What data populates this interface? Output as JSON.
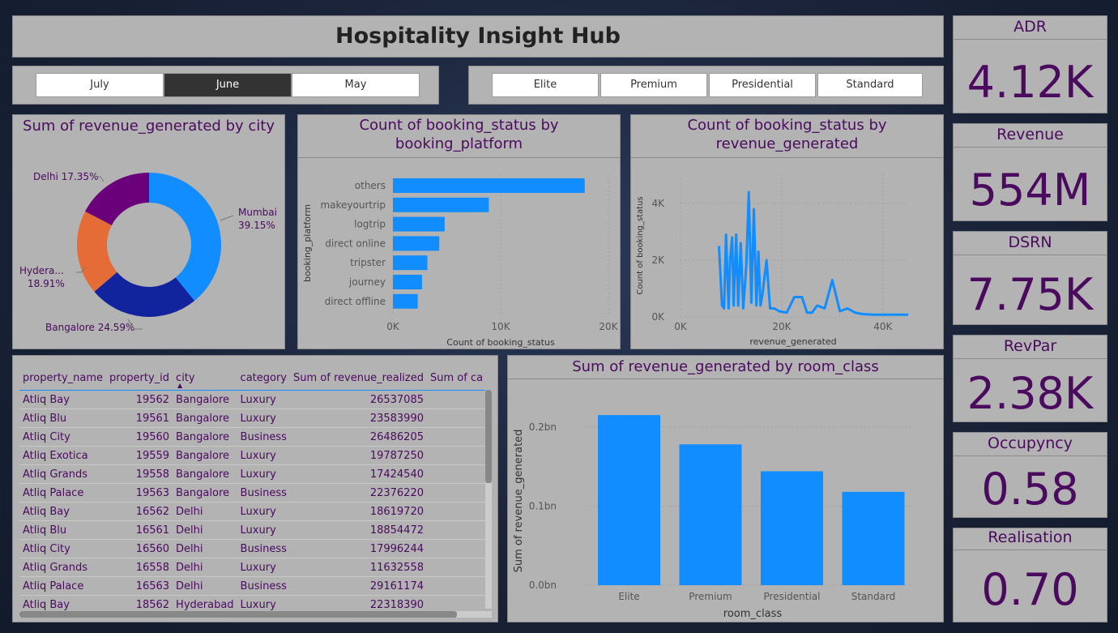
{
  "header": {
    "title": "Hospitality Insight Hub"
  },
  "month_slicer": {
    "options": [
      "July",
      "June",
      "May"
    ],
    "selected": "June"
  },
  "class_slicer": {
    "options": [
      "Elite",
      "Premium",
      "Presidential",
      "Standard"
    ]
  },
  "kpis": [
    {
      "label": "ADR",
      "value": "4.12K"
    },
    {
      "label": "Revenue",
      "value": "554M"
    },
    {
      "label": "DSRN",
      "value": "7.75K"
    },
    {
      "label": "RevPar",
      "value": "2.38K"
    },
    {
      "label": "Occupyncy",
      "value": "0.58"
    },
    {
      "label": "Realisation",
      "value": "0.70"
    }
  ],
  "colors": {
    "accent": "#118dff",
    "title_text": "#4a0a5e",
    "panel": "#b3b3b3"
  },
  "chart_data": [
    {
      "type": "pie",
      "title": "Sum of revenue_generated by city",
      "categories": [
        "Mumbai",
        "Bangalore",
        "Hydera...",
        "Delhi"
      ],
      "values": [
        39.15,
        24.59,
        18.91,
        17.35
      ],
      "labels": [
        "Mumbai 39.15%",
        "Bangalore 24.59%",
        "Hydera... 18.91%",
        "Delhi 17.35%"
      ],
      "colors": [
        "#118dff",
        "#12239e",
        "#e66c37",
        "#6b007b"
      ]
    },
    {
      "type": "bar",
      "orientation": "horizontal",
      "title": "Count of booking_status by booking_platform",
      "categories": [
        "others",
        "makeyourtrip",
        "logtrip",
        "direct online",
        "tripster",
        "journey",
        "direct offline"
      ],
      "values": [
        17800,
        8900,
        4800,
        4300,
        3200,
        2700,
        2300
      ],
      "xlabel": "Count of booking_status",
      "ylabel": "booking_platform",
      "xlim": [
        0,
        20000
      ],
      "ticks": [
        "0K",
        "10K",
        "20K"
      ]
    },
    {
      "type": "line",
      "title": "Count of booking_status by revenue_generated",
      "x": [
        7600,
        8200,
        8600,
        9000,
        9500,
        9800,
        10200,
        10500,
        11000,
        11400,
        11900,
        12400,
        13000,
        13500,
        14000,
        14500,
        15000,
        15400,
        15800,
        16200,
        17000,
        17700,
        18500,
        19500,
        21000,
        22500,
        24000,
        25000,
        26000,
        27000,
        28500,
        30000,
        31500,
        33000,
        34500,
        36000,
        38000,
        40000,
        42000,
        45000
      ],
      "y": [
        2500,
        400,
        300,
        2900,
        300,
        2000,
        2800,
        400,
        2900,
        400,
        2600,
        300,
        1800,
        4400,
        500,
        3800,
        400,
        2300,
        400,
        800,
        2000,
        300,
        300,
        200,
        150,
        700,
        700,
        150,
        150,
        400,
        300,
        1300,
        200,
        300,
        150,
        100,
        80,
        80,
        80,
        80
      ],
      "xlabel": "revenue_generated",
      "ylabel": "Count of booking_status",
      "xlim": [
        0,
        45000
      ],
      "ylim": [
        0,
        4600
      ],
      "xticks": [
        "0K",
        "20K",
        "40K"
      ],
      "yticks": [
        "0K",
        "2K",
        "4K"
      ]
    },
    {
      "type": "bar",
      "title": "Sum of revenue_generated by room_class",
      "categories": [
        "Elite",
        "Premium",
        "Presidential",
        "Standard"
      ],
      "values": [
        0.215,
        0.178,
        0.144,
        0.118
      ],
      "xlabel": "room_class",
      "ylabel": "Sum of revenue_generated",
      "ylim": [
        0,
        0.25
      ],
      "yticks": [
        "0.0bn",
        "0.1bn",
        "0.2bn"
      ]
    }
  ],
  "table": {
    "columns": [
      "property_name",
      "property_id",
      "city",
      "category",
      "Sum of revenue_realized",
      "Sum of ca"
    ],
    "rows": [
      [
        "Atliq Bay",
        "19562",
        "Bangalore",
        "Luxury",
        "26537085"
      ],
      [
        "Atliq Blu",
        "19561",
        "Bangalore",
        "Luxury",
        "23583990"
      ],
      [
        "Atliq City",
        "19560",
        "Bangalore",
        "Business",
        "26486205"
      ],
      [
        "Atliq Exotica",
        "19559",
        "Bangalore",
        "Luxury",
        "19787250"
      ],
      [
        "Atliq Grands",
        "19558",
        "Bangalore",
        "Luxury",
        "17424540"
      ],
      [
        "Atliq Palace",
        "19563",
        "Bangalore",
        "Business",
        "22376220"
      ],
      [
        "Atliq Bay",
        "16562",
        "Delhi",
        "Luxury",
        "18619720"
      ],
      [
        "Atliq Blu",
        "16561",
        "Delhi",
        "Luxury",
        "18854472"
      ],
      [
        "Atliq City",
        "16560",
        "Delhi",
        "Business",
        "17996244"
      ],
      [
        "Atliq Grands",
        "16558",
        "Delhi",
        "Luxury",
        "11632558"
      ],
      [
        "Atliq Palace",
        "16563",
        "Delhi",
        "Business",
        "29161174"
      ],
      [
        "Atliq Bay",
        "18562",
        "Hyderabad",
        "Luxury",
        "22318390"
      ]
    ]
  }
}
